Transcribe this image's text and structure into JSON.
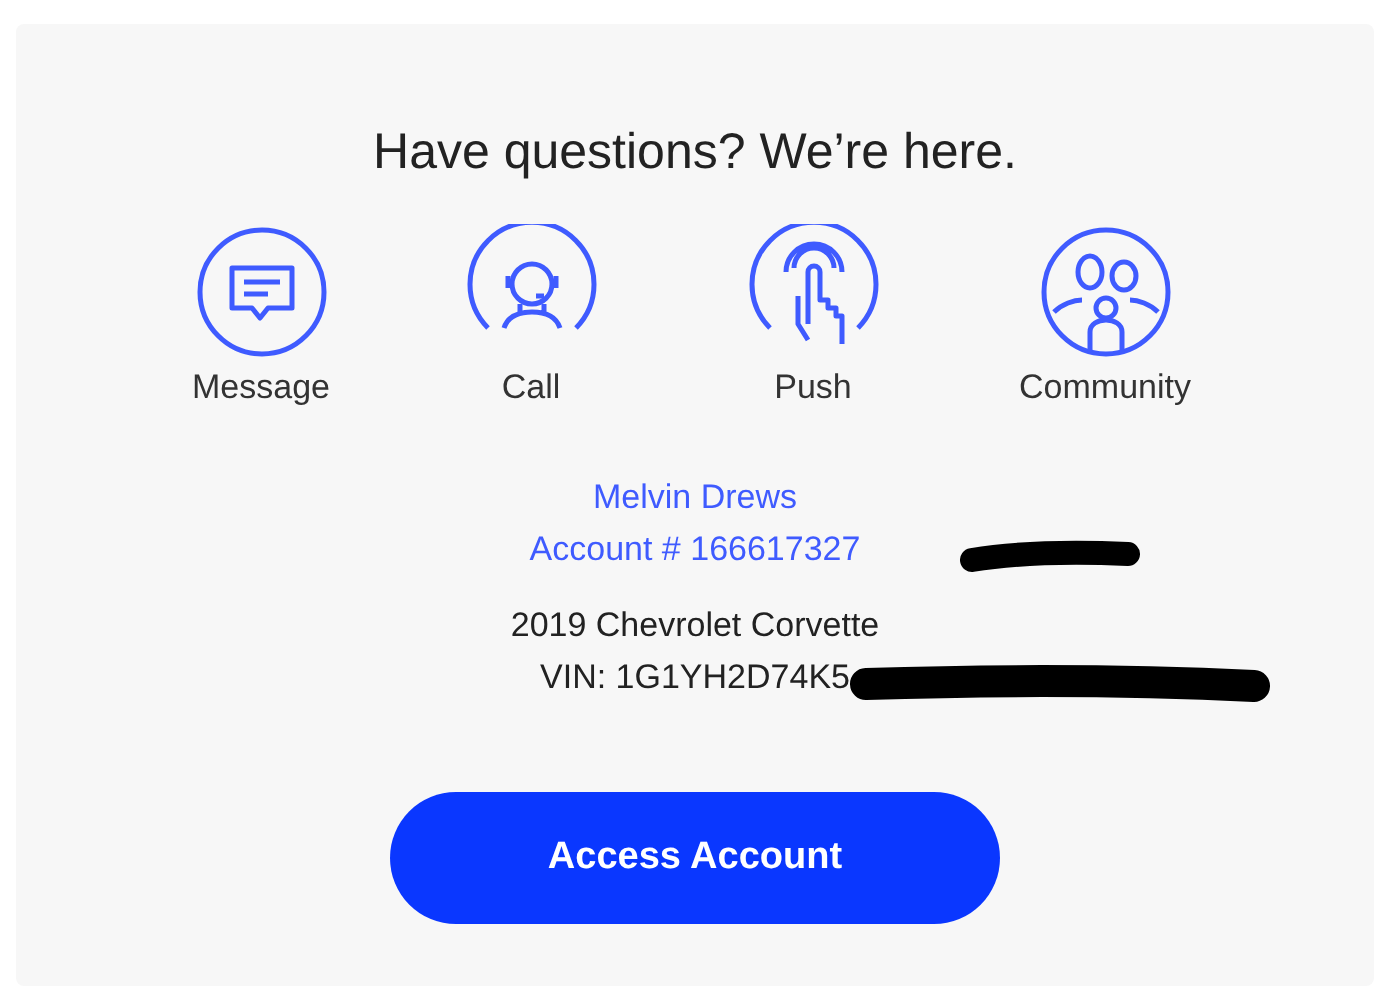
{
  "heading": "Have questions? We’re here.",
  "contact_options": [
    {
      "kind": "message",
      "label": "Message"
    },
    {
      "kind": "call",
      "label": "Call"
    },
    {
      "kind": "push",
      "label": "Push"
    },
    {
      "kind": "community",
      "label": "Community"
    }
  ],
  "account": {
    "name": "Melvin Drews",
    "number": "Account # 166617327"
  },
  "vehicle": {
    "model": "2019 Chevrolet Corvette",
    "vin": "VIN: 1G1YH2D74K5"
  },
  "button": "Access Account"
}
